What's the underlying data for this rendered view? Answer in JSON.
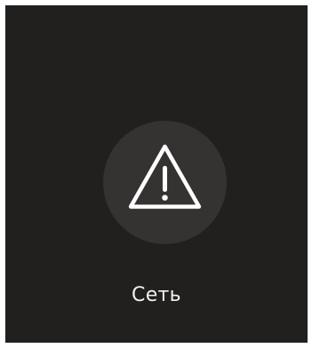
{
  "tile": {
    "icon": "warning-icon",
    "label": "Сеть"
  },
  "colors": {
    "background": "#221f1f",
    "icon_circle": "#353232",
    "icon_stroke": "#ffffff",
    "text": "#f2f2f2"
  }
}
